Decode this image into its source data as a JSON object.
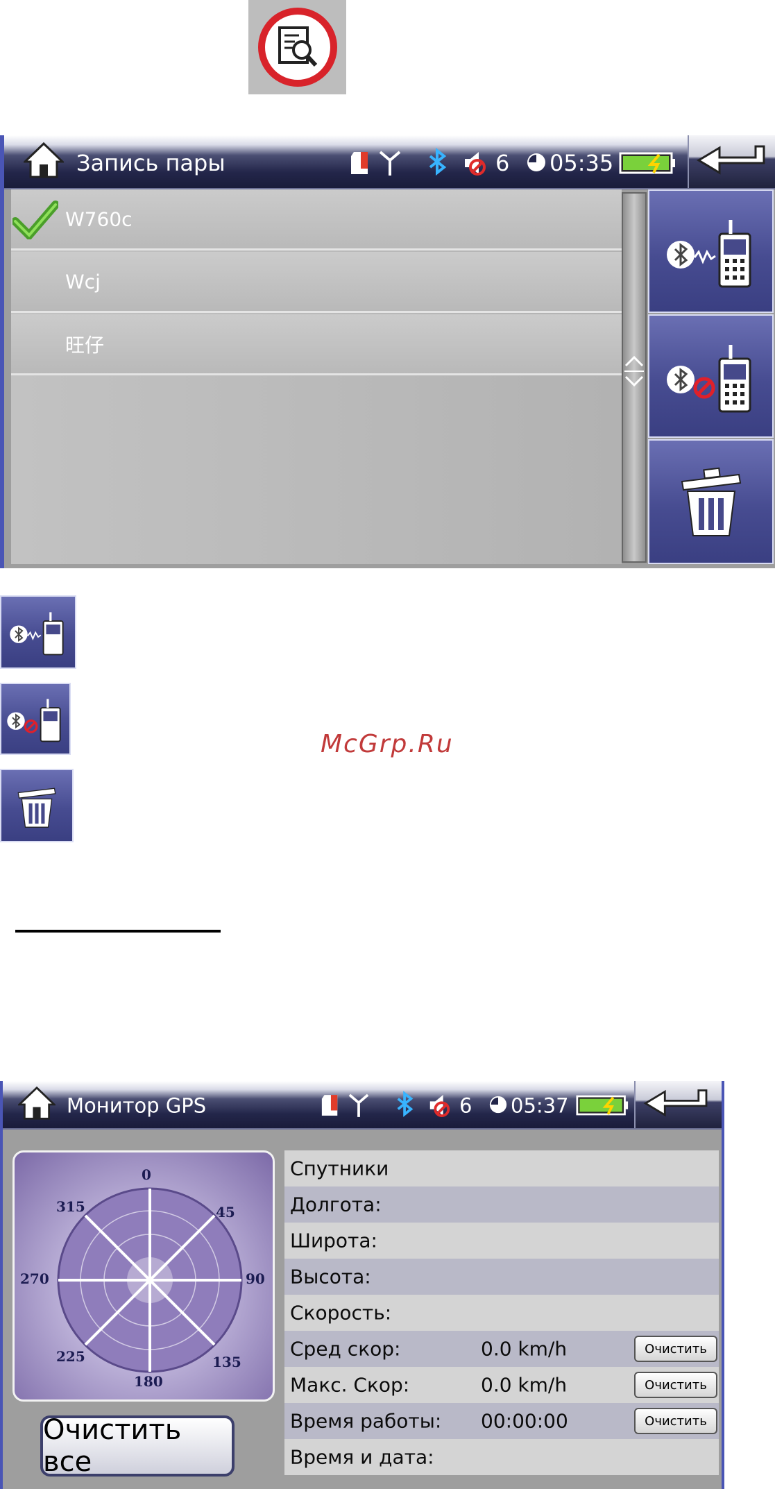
{
  "pairing_screen": {
    "title": "Запись пары",
    "status": {
      "count": "6",
      "time": "05:35"
    },
    "devices": [
      {
        "name": "W760c",
        "connected": true
      },
      {
        "name": "Wcj",
        "connected": false
      },
      {
        "name": "旺仔",
        "connected": false
      }
    ],
    "side_buttons": [
      "bluetooth-connect-phone-icon",
      "bluetooth-disconnect-phone-icon",
      "trash-icon"
    ]
  },
  "legend_buttons": [
    "bluetooth-connect-phone-icon",
    "bluetooth-disconnect-phone-icon",
    "trash-icon"
  ],
  "watermark": "McGrp.Ru",
  "gps_screen": {
    "title": "Монитор GPS",
    "status": {
      "count": "6",
      "time": "05:37"
    },
    "compass": {
      "ticks": [
        "0",
        "45",
        "90",
        "135",
        "180",
        "225",
        "270",
        "315"
      ]
    },
    "rows": [
      {
        "key": "Спутники",
        "value": "",
        "button": ""
      },
      {
        "key": "Долгота:",
        "value": "",
        "button": ""
      },
      {
        "key": "Широта:",
        "value": "",
        "button": ""
      },
      {
        "key": "Высота:",
        "value": "",
        "button": ""
      },
      {
        "key": "Скорость:",
        "value": "",
        "button": ""
      },
      {
        "key": "Сред скор:",
        "value": "0.0 km/h",
        "button": "Очистить"
      },
      {
        "key": "Макс. Скор:",
        "value": "0.0 km/h",
        "button": "Очистить"
      },
      {
        "key": "Время работы:",
        "value": "00:00:00",
        "button": "Очистить"
      },
      {
        "key": "Время и дата:",
        "value": "",
        "button": ""
      }
    ],
    "clear_all_label": "Очистить все"
  },
  "colors": {
    "accent": "#4a55b5",
    "watermark": "#c13a3a",
    "battery": "#7ad13b"
  }
}
